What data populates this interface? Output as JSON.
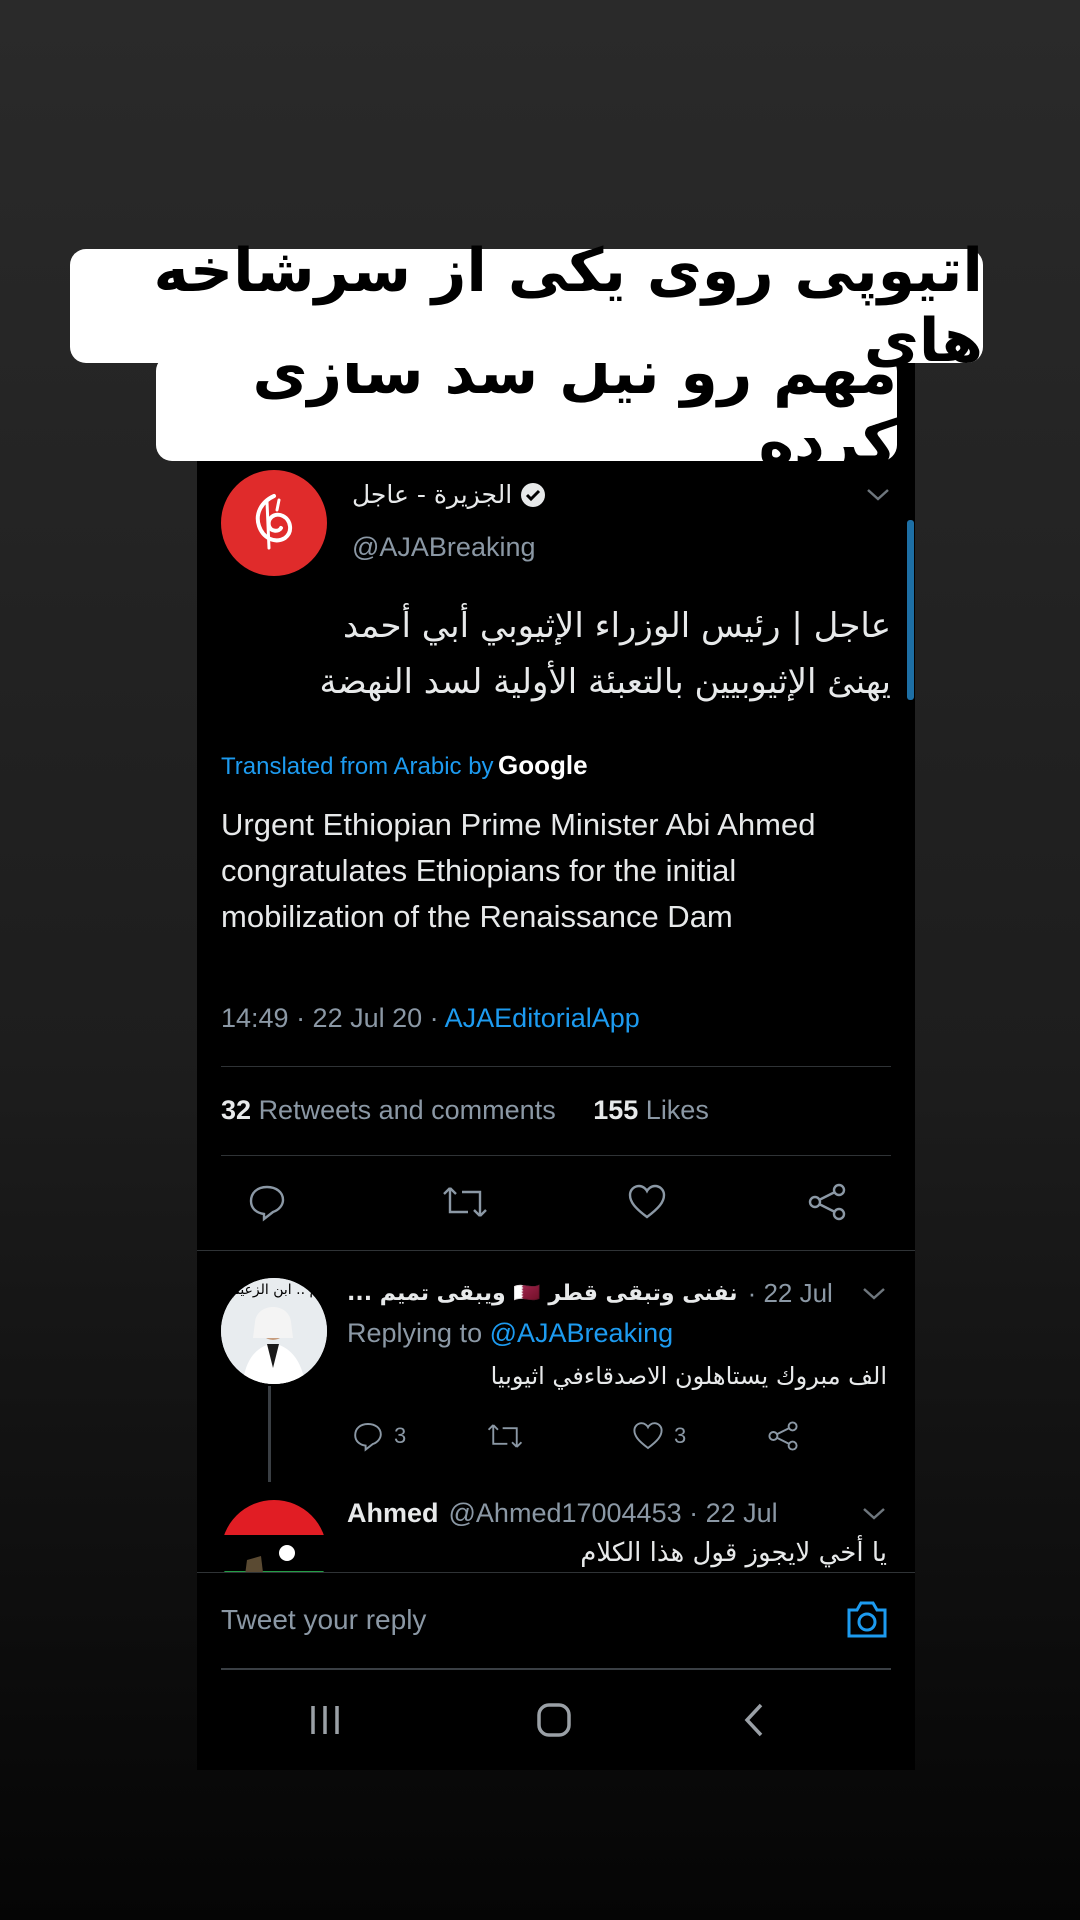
{
  "caption": {
    "line1": "اتیوپی روی یکی از سرشاخه های",
    "line2": "مهم رو نیل سد سازی کرده"
  },
  "tweet": {
    "avatar_icon": "al-jazeera-logo",
    "name": "الجزيرة - عاجل",
    "handle": "@AJABreaking",
    "text_line1": "عاجل | رئيس الوزراء الإثيوبي أبي أحمد",
    "text_line2": "يهنئ الإثيوبيين بالتعبئة الأولية لسد النهضة",
    "translated_label": "Translated from Arabic by",
    "translated_brand": "Google",
    "translation": "Urgent Ethiopian Prime Minister Abi Ahmed congratulates Ethiopians for the initial mobilization of the Renaissance Dam",
    "time": "14:49 · 22 Jul 20 · ",
    "app": "AJAEditorialApp",
    "retweets_count": "32",
    "retweets_label": "Retweets and comments",
    "likes_count": "155",
    "likes_label": "Likes"
  },
  "replies": [
    {
      "avatar_text": "رعيم .. ابن الزعيم",
      "name": "نفنى وتبقى قطر 🇶🇦 ويبقى تميم ...",
      "date": "· 22 Jul",
      "replying_prefix": "Replying to",
      "replying_handle": "@AJABreaking",
      "text": "الف مبروك يستاهلون الاصدقاءفي اثيوبيا",
      "comments": "3",
      "likes": "3"
    },
    {
      "name": "Ahmed",
      "handle_date": "@Ahmed17004453 · 22 Jul",
      "text": "يا أخي لايجوز قول هذا الكلام"
    }
  ],
  "reply_input": {
    "placeholder": "Tweet your reply"
  },
  "colors": {
    "accent": "#1d9bf0",
    "brand_red": "#e02b2b"
  }
}
